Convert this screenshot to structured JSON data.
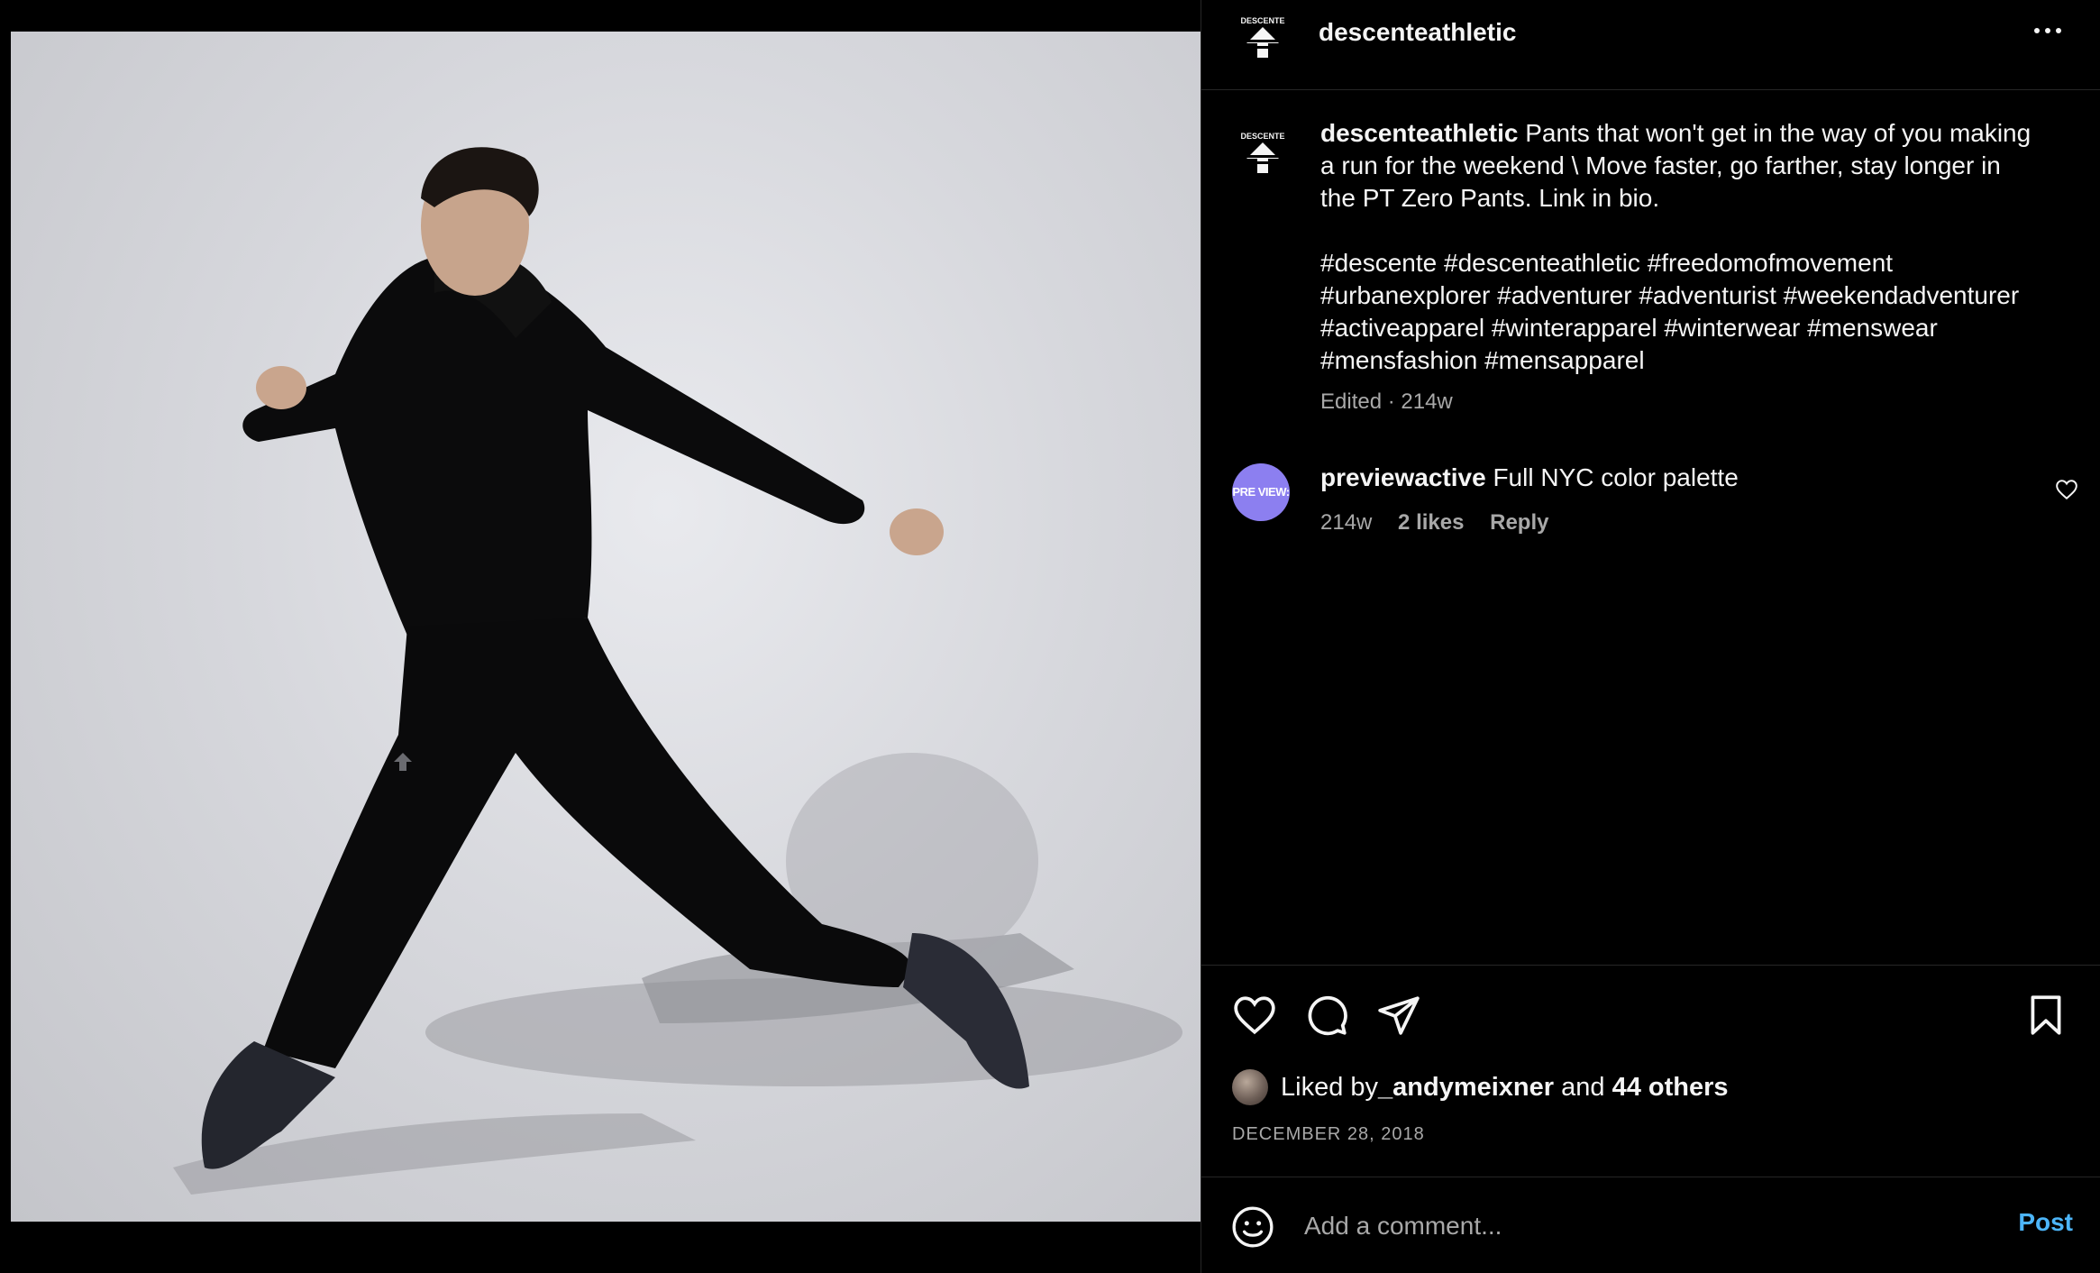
{
  "post": {
    "author": "descenteathletic",
    "logo_text": "DESCENTE",
    "caption_text": "Pants that won't get in the way of you making a run for the weekend \\ Move faster, go farther, stay longer in the PT Zero Pants. Link in bio.",
    "hashtags": "#descente #descenteathletic #freedomofmovement #urbanexplorer #adventurer #adventurist #weekendadventurer #activeapparel #winterapparel #winterwear #menswear #mensfashion #mensapparel",
    "edited_label": "Edited · 214w"
  },
  "comment": {
    "avatar_text": "PRE VIEW:",
    "username": "previewactive",
    "text": "Full NYC color palette",
    "age": "214w",
    "likes": "2 likes",
    "reply": "Reply"
  },
  "likes": {
    "prefix": "Liked by ",
    "user": "_andymeixner",
    "middle": " and ",
    "others": "44 others"
  },
  "date": "DECEMBER 28, 2018",
  "composer": {
    "placeholder": "Add a comment...",
    "post_label": "Post"
  },
  "icons": {
    "more": "more-options-icon",
    "heart": "heart-icon",
    "comment": "comment-icon",
    "share": "share-icon",
    "bookmark": "bookmark-icon",
    "emoji": "emoji-icon"
  },
  "colors": {
    "background": "#000000",
    "text": "#f5f5f5",
    "muted": "#a8a8a8",
    "link_blue": "#4cb5f9",
    "comment_avatar": "#8c7ff0"
  }
}
